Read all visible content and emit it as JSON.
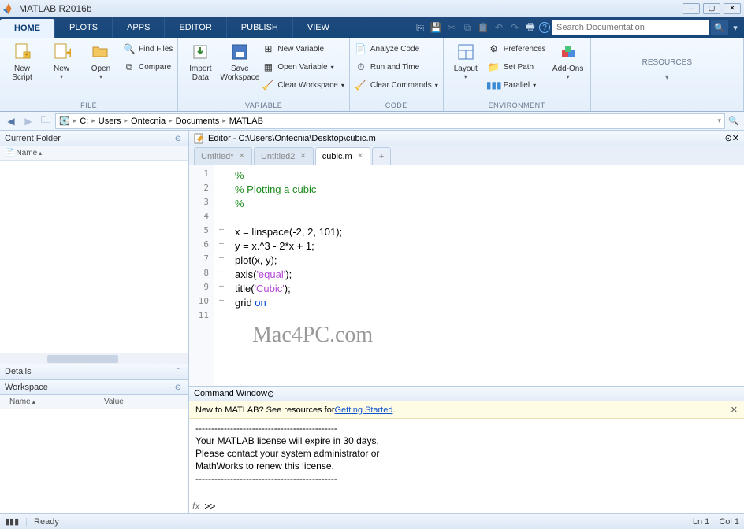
{
  "window": {
    "title": "MATLAB R2016b"
  },
  "tabs": [
    "HOME",
    "PLOTS",
    "APPS",
    "EDITOR",
    "PUBLISH",
    "VIEW"
  ],
  "activeTab": 0,
  "search": {
    "placeholder": "Search Documentation"
  },
  "ribbon": {
    "file": {
      "label": "FILE",
      "newScript": "New\nScript",
      "new": "New",
      "open": "Open",
      "findFiles": "Find Files",
      "compare": "Compare"
    },
    "variable": {
      "label": "VARIABLE",
      "importData": "Import\nData",
      "saveWorkspace": "Save\nWorkspace",
      "newVariable": "New Variable",
      "openVariable": "Open Variable",
      "clearWorkspace": "Clear Workspace"
    },
    "code": {
      "label": "CODE",
      "analyzeCode": "Analyze Code",
      "runAndTime": "Run and Time",
      "clearCommands": "Clear Commands"
    },
    "environment": {
      "label": "ENVIRONMENT",
      "layout": "Layout",
      "preferences": "Preferences",
      "setPath": "Set Path",
      "parallel": "Parallel",
      "addons": "Add-Ons"
    },
    "resources": {
      "label": "RESOURCES"
    }
  },
  "path": {
    "drive": "C:",
    "crumbs": [
      "Users",
      "Ontecnia",
      "Documents",
      "MATLAB"
    ]
  },
  "panels": {
    "currentFolder": {
      "title": "Current Folder",
      "nameCol": "Name"
    },
    "details": {
      "title": "Details"
    },
    "workspace": {
      "title": "Workspace",
      "nameCol": "Name",
      "valueCol": "Value"
    },
    "editor": {
      "title": "Editor - C:\\Users\\Ontecnia\\Desktop\\cubic.m"
    },
    "commandWindow": {
      "title": "Command Window"
    }
  },
  "editorTabs": [
    {
      "label": "Untitled*",
      "active": false
    },
    {
      "label": "Untitled2",
      "active": false
    },
    {
      "label": "cubic.m",
      "active": true
    }
  ],
  "codeLines": [
    {
      "n": 1,
      "bp": "",
      "seg": [
        [
          "cmt",
          "%"
        ]
      ]
    },
    {
      "n": 2,
      "bp": "",
      "seg": [
        [
          "cmt",
          "% Plotting a cubic"
        ]
      ]
    },
    {
      "n": 3,
      "bp": "",
      "seg": [
        [
          "cmt",
          "%"
        ]
      ]
    },
    {
      "n": 4,
      "bp": "",
      "seg": [
        [
          "",
          ""
        ]
      ]
    },
    {
      "n": 5,
      "bp": "–",
      "seg": [
        [
          "",
          "x = linspace(-2, 2, 101);"
        ]
      ]
    },
    {
      "n": 6,
      "bp": "–",
      "seg": [
        [
          "",
          "y = x.^3 - 2*x + 1;"
        ]
      ]
    },
    {
      "n": 7,
      "bp": "–",
      "seg": [
        [
          "",
          "plot(x, y);"
        ]
      ]
    },
    {
      "n": 8,
      "bp": "–",
      "seg": [
        [
          "",
          "axis("
        ],
        [
          "str",
          "'equal'"
        ],
        [
          "",
          ");"
        ]
      ]
    },
    {
      "n": 9,
      "bp": "–",
      "seg": [
        [
          "",
          "title("
        ],
        [
          "str",
          "'Cubic'"
        ],
        [
          "",
          ");"
        ]
      ]
    },
    {
      "n": 10,
      "bp": "–",
      "seg": [
        [
          "",
          "grid "
        ],
        [
          "kwd",
          "on"
        ]
      ]
    },
    {
      "n": 11,
      "bp": "",
      "seg": [
        [
          "",
          ""
        ]
      ]
    }
  ],
  "watermark": "Mac4PC.com",
  "commandBanner": {
    "prefix": "New to MATLAB? See resources for ",
    "link": "Getting Started",
    "suffix": "."
  },
  "commandOutput": [
    "---------------------------------------------",
    "Your MATLAB license will expire in 30 days.",
    "Please contact your system administrator or",
    "MathWorks to renew this license.",
    "---------------------------------------------"
  ],
  "commandPrompt": ">>",
  "status": {
    "state": "Ready",
    "line": "Ln  1",
    "col": "Col  1"
  }
}
